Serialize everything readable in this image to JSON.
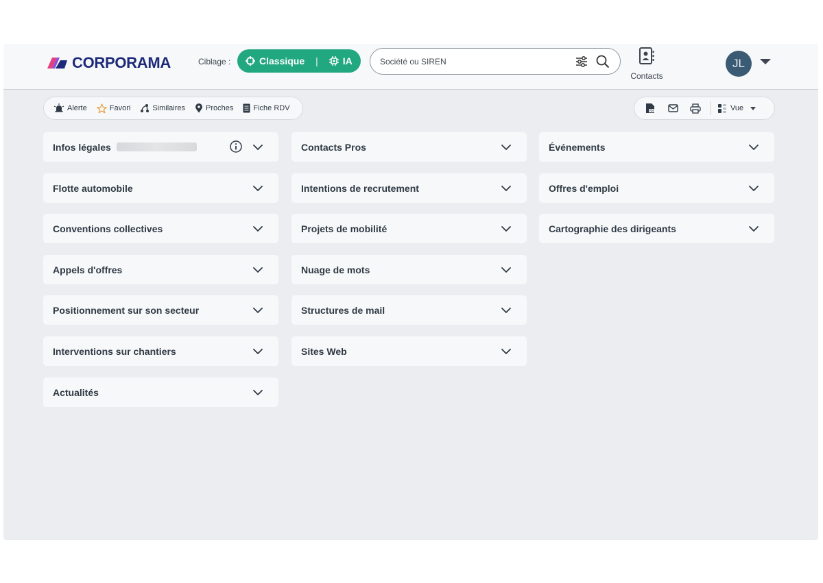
{
  "header": {
    "logo_text": "CORPORAMA",
    "ciblage_label": "Ciblage :",
    "ciblage_options": {
      "classique": "Classique",
      "ia": "IA"
    },
    "search_placeholder": "Société ou SIREN",
    "contacts_label": "Contacts",
    "avatar_initials": "JL"
  },
  "toolbar": {
    "left": {
      "alerte": "Alerte",
      "favori": "Favori",
      "similaires": "Similaires",
      "proches": "Proches",
      "fiche_rdv": "Fiche RDV"
    },
    "right": {
      "vue": "Vue"
    }
  },
  "sections": {
    "col1": [
      "Infos légales",
      "Flotte automobile",
      "Conventions collectives",
      "Appels d'offres",
      "Positionnement sur son secteur",
      "Interventions sur chantiers",
      "Actualités"
    ],
    "col2": [
      "Contacts Pros",
      "Intentions de recrutement",
      "Projets de mobilité",
      "Nuage de mots",
      "Structures de mail",
      "Sites Web"
    ],
    "col3": [
      "Événements",
      "Offres d'emploi",
      "Cartographie des dirigeants"
    ]
  },
  "colors": {
    "accent_green": "#22a881",
    "brand_navy": "#1d2a79",
    "avatar": "#3b5a73"
  }
}
